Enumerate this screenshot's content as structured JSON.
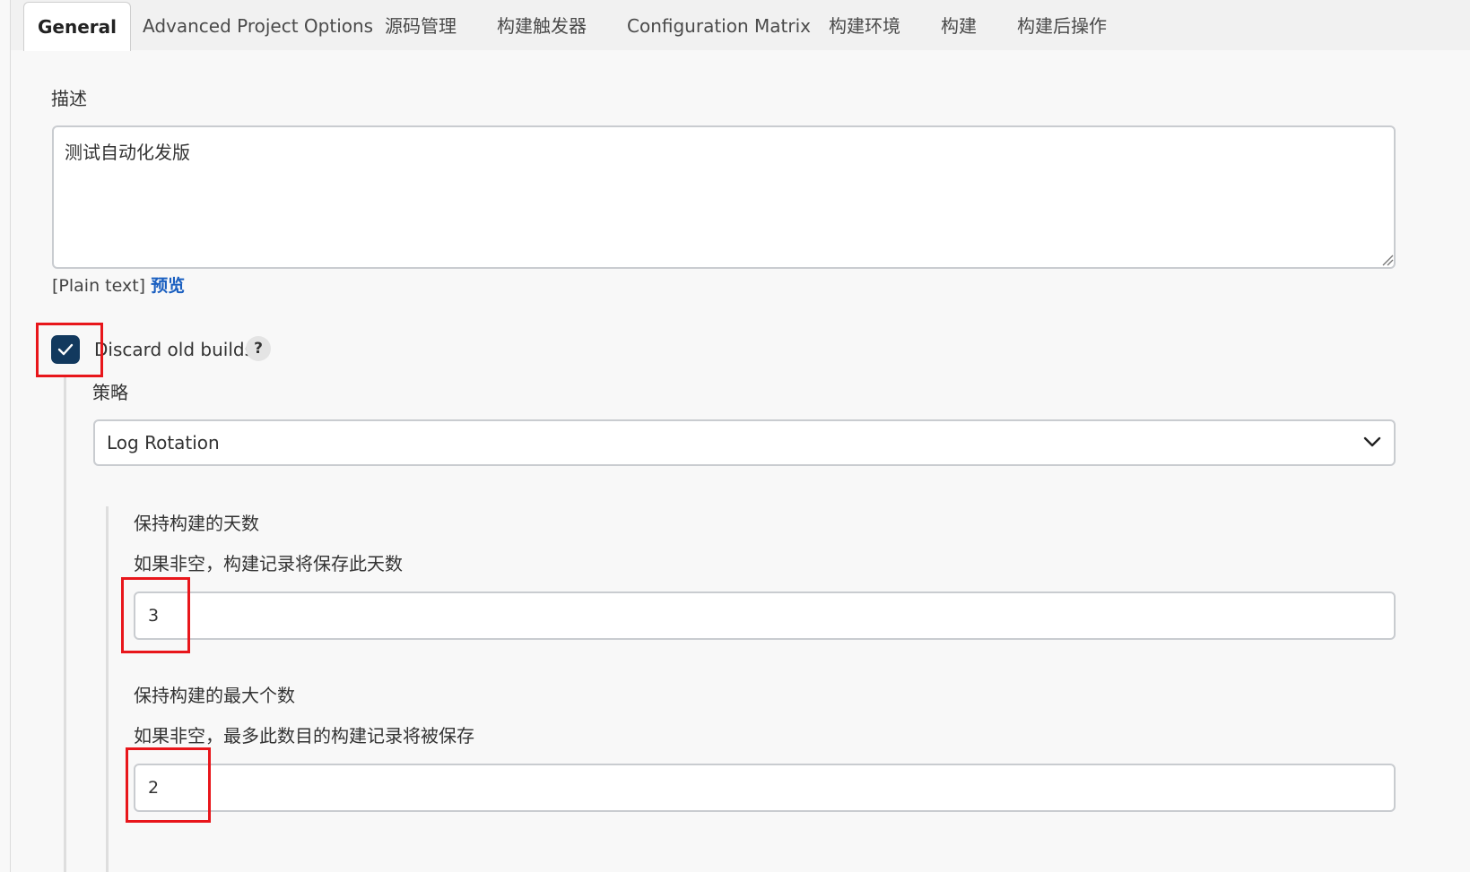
{
  "tabs": [
    {
      "label": "General",
      "active": true
    },
    {
      "label": "Advanced Project Options",
      "active": false
    },
    {
      "label": "源码管理",
      "active": false
    },
    {
      "label": "构建触发器",
      "active": false
    },
    {
      "label": "Configuration Matrix",
      "active": false
    },
    {
      "label": "构建环境",
      "active": false
    },
    {
      "label": "构建",
      "active": false
    },
    {
      "label": "构建后操作",
      "active": false
    }
  ],
  "description": {
    "label": "描述",
    "value": "测试自动化发版",
    "format_text": "[Plain text]",
    "preview_link": "预览"
  },
  "discard_old_builds": {
    "checked": true,
    "label": "Discard old builds",
    "help_icon": "?",
    "strategy_label": "策略",
    "strategy_value": "Log Rotation",
    "days_to_keep": {
      "label": "保持构建的天数",
      "help": "如果非空，构建记录将保存此天数",
      "value": "3"
    },
    "max_builds": {
      "label": "保持构建的最大个数",
      "help": "如果非空，最多此数目的构建记录将被保存",
      "value": "2"
    }
  },
  "colors": {
    "checkbox": "#12395e",
    "link": "#1a5fc0",
    "highlight": "#e8161b"
  }
}
